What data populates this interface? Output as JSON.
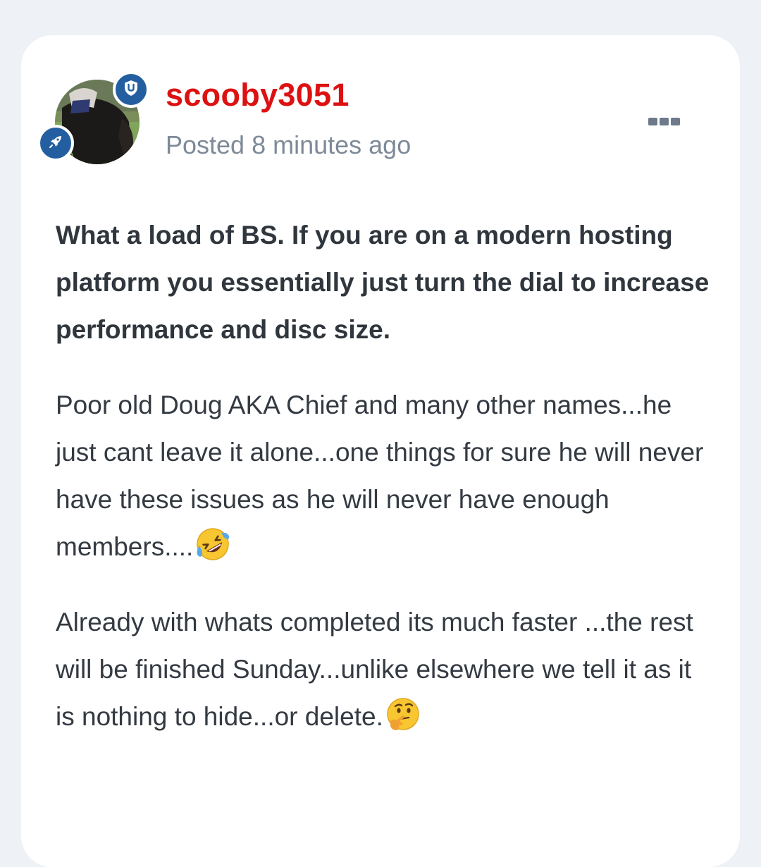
{
  "post": {
    "author": "scooby3051",
    "posted": "Posted 8 minutes ago",
    "paragraphs": [
      "What a load of BS.  If you are on a modern hosting platform you essentially just turn the dial to increase performance and disc size.",
      "Poor old Doug AKA Chief and many other names...he just cant leave it alone...one things for sure he will never have these issues as he will never have enough members....",
      "Already with whats completed its much faster ...the rest will be finished Sunday...unlike elsewhere we tell it as it is nothing to hide...or delete."
    ],
    "emojis": [
      "rolling-on-floor-laughing-emoji",
      "thinking-face-emoji"
    ]
  },
  "colors": {
    "author": "#dd1111",
    "meta": "#7e8a98",
    "badge": "#235fa0",
    "text": "#343a42"
  },
  "icons": [
    "shield-icon",
    "rocket-icon",
    "more-options-icon"
  ]
}
